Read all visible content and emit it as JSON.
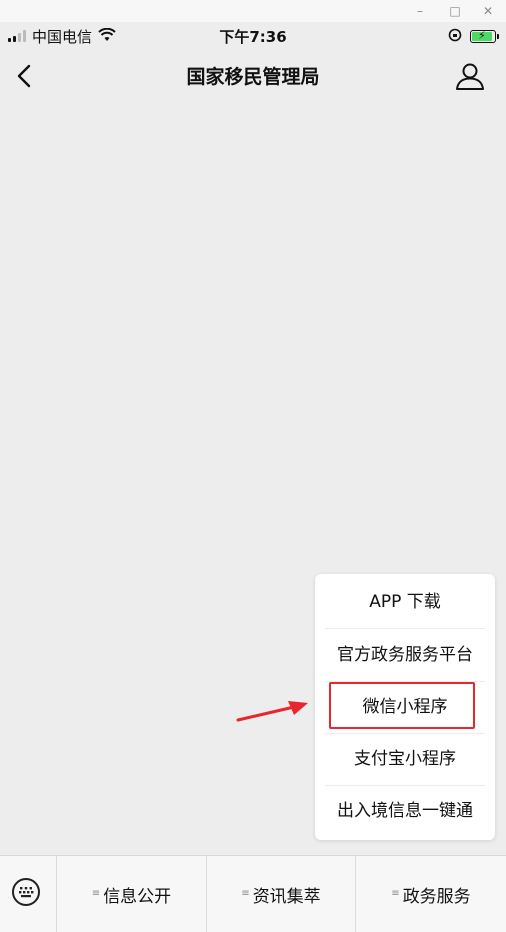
{
  "status": {
    "carrier": "中国电信",
    "time": "下午7:36"
  },
  "nav": {
    "title": "国家移民管理局"
  },
  "popup": {
    "items": [
      "APP 下载",
      "官方政务服务平台",
      "微信小程序",
      "支付宝小程序",
      "出入境信息一键通"
    ]
  },
  "bottom_menu": {
    "tabs": [
      "信息公开",
      "资讯集萃",
      "政务服务"
    ]
  },
  "colors": {
    "background": "#ededed",
    "highlight": "#e8262d",
    "battery": "#4cd964"
  },
  "icons": [
    "back-arrow-icon",
    "user-icon",
    "keyboard-icon",
    "wifi-icon",
    "signal-icon",
    "battery-icon",
    "menu-lines-icon"
  ]
}
